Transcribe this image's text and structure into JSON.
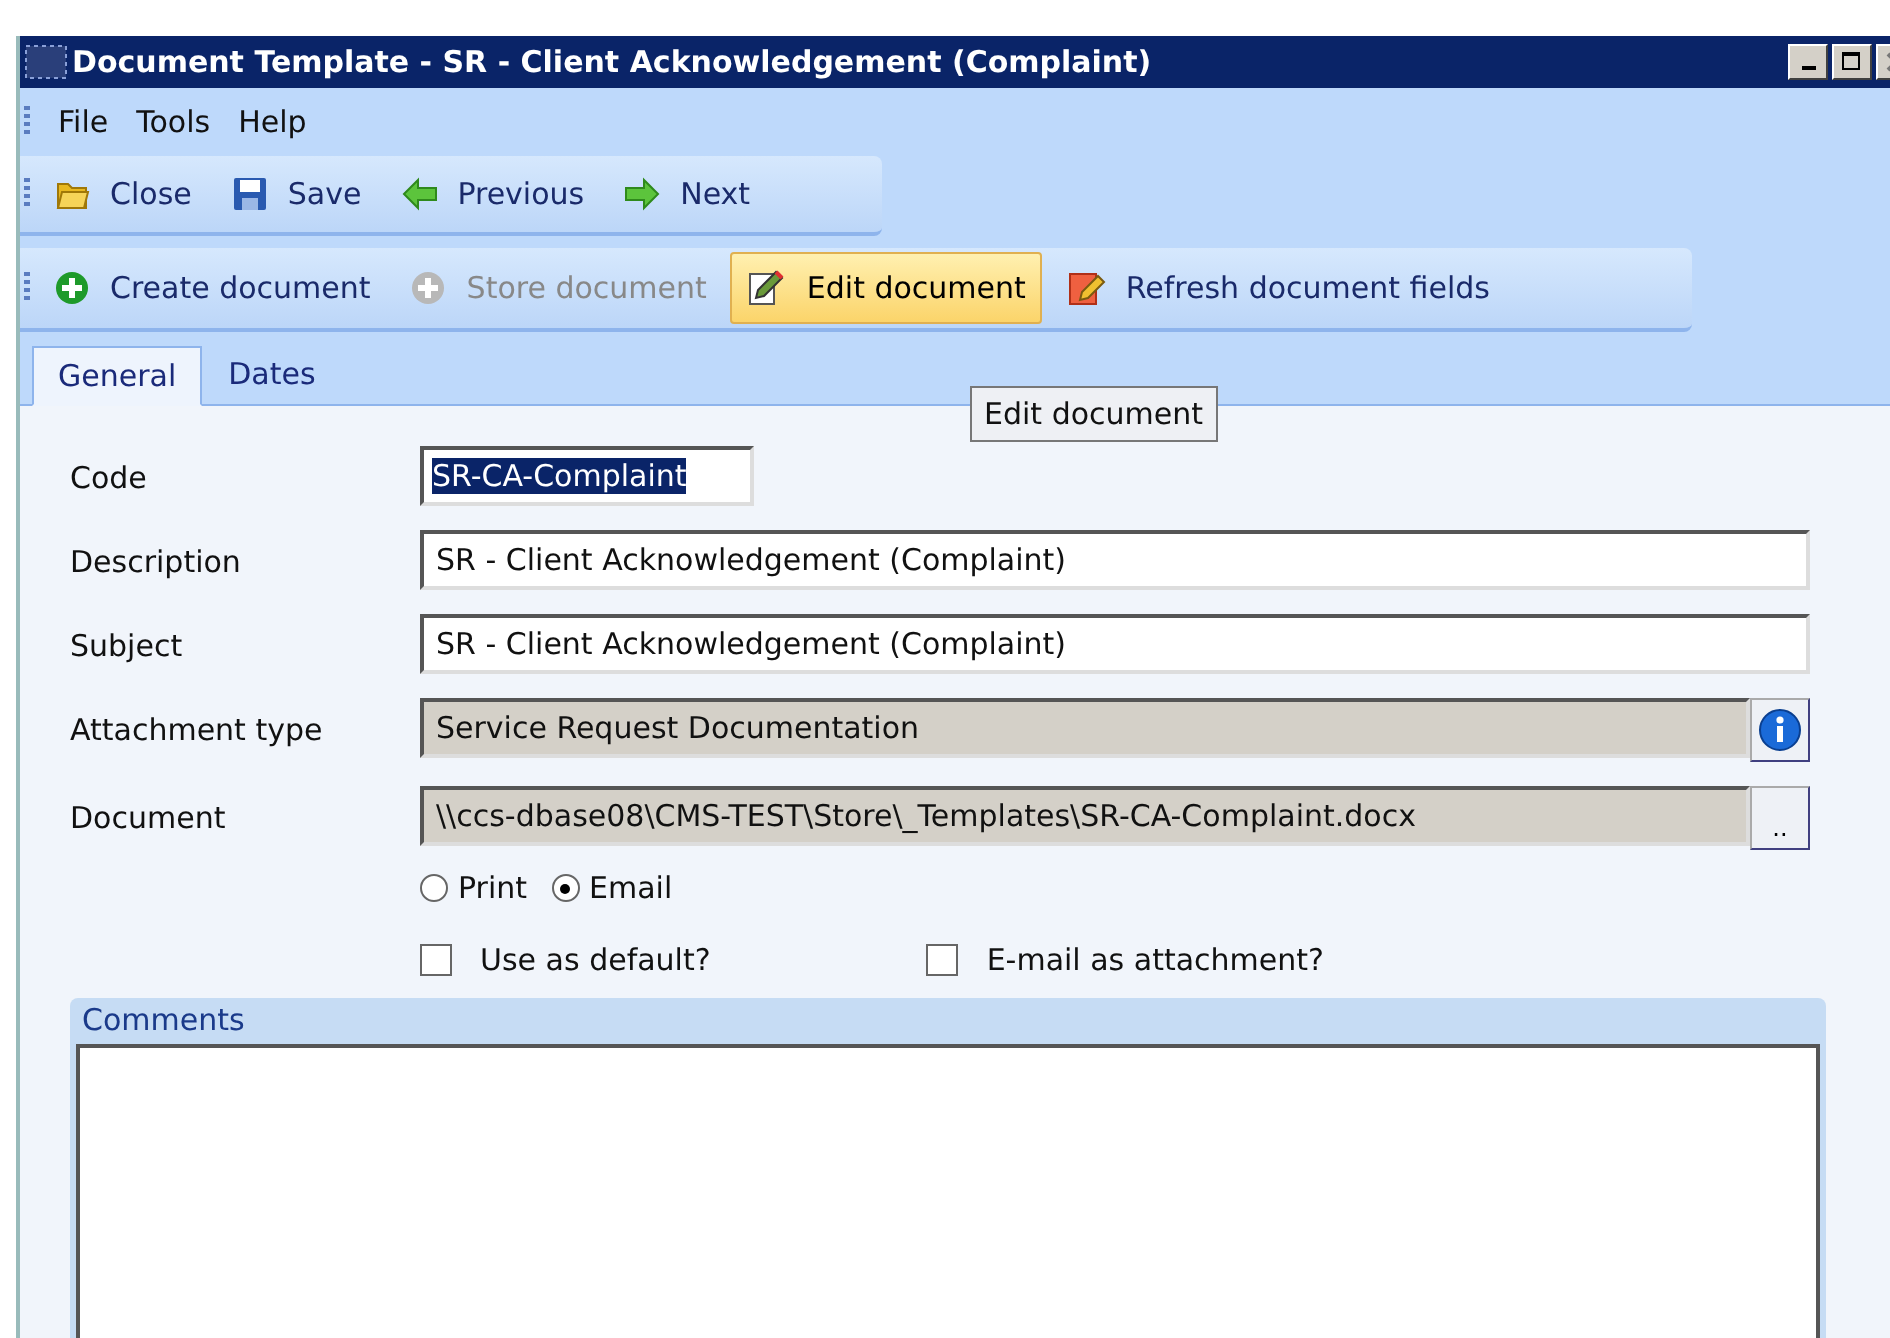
{
  "window": {
    "title": "Document Template  - SR - Client Acknowledgement (Complaint)"
  },
  "menu": [
    "File",
    "Tools",
    "Help"
  ],
  "toolbar_1": [
    {
      "label": "Close",
      "kind": "folder",
      "disabled": false,
      "highlighted": false
    },
    {
      "label": "Save",
      "kind": "disk",
      "disabled": false,
      "highlighted": false
    },
    {
      "label": "Previous",
      "kind": "left",
      "disabled": false,
      "highlighted": false
    },
    {
      "label": "Next",
      "kind": "right",
      "disabled": false,
      "highlighted": false
    }
  ],
  "toolbar_2": [
    {
      "label": "Create document",
      "kind": "plus",
      "disabled": false,
      "highlighted": false
    },
    {
      "label": "Store document",
      "kind": "plus",
      "disabled": true,
      "highlighted": false
    },
    {
      "label": "Edit document",
      "kind": "edit",
      "disabled": false,
      "highlighted": true
    },
    {
      "label": "Refresh document fields",
      "kind": "refresh",
      "disabled": false,
      "highlighted": false
    }
  ],
  "tooltip": "Edit document",
  "tabs": [
    {
      "label": "General",
      "selected": true
    },
    {
      "label": "Dates",
      "selected": false
    }
  ],
  "fields": [
    {
      "label": "Code",
      "value": "SR-CA-Complaint",
      "kind": "short",
      "text_selected": true
    },
    {
      "label": "Description",
      "value": "SR - Client Acknowledgement (Complaint)",
      "kind": "text",
      "text_selected": false
    },
    {
      "label": "Subject",
      "value": "SR - Client Acknowledgement (Complaint)",
      "kind": "text",
      "text_selected": false
    },
    {
      "label": "Attachment type",
      "value": "Service Request Documentation",
      "kind": "readonly",
      "text_selected": false,
      "action": {
        "kind": "info"
      }
    },
    {
      "label": "Document",
      "value": "\\\\ccs-dbase08\\CMS-TEST\\Store\\_Templates\\SR-CA-Complaint.docx",
      "kind": "readonly",
      "text_selected": false,
      "action": {
        "kind": "browse",
        "label": ".."
      }
    }
  ],
  "radios": [
    {
      "label": "Print",
      "selected": false
    },
    {
      "label": "Email",
      "selected": true
    }
  ],
  "checkboxes": [
    {
      "label": "Use as default?",
      "checked": false
    },
    {
      "label": "E-mail as attachment?",
      "checked": false
    }
  ],
  "comments": {
    "title": "Comments"
  }
}
